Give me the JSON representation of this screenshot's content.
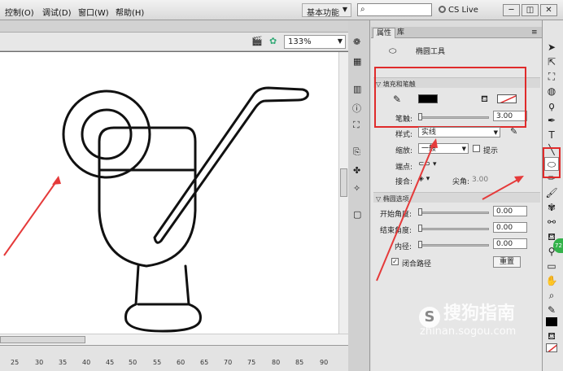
{
  "menu": {
    "items": [
      "控制(O)",
      "调试(D)",
      "窗口(W)",
      "帮助(H)"
    ]
  },
  "workspace": {
    "label": "基本功能"
  },
  "cslive": {
    "label": "CS Live"
  },
  "search": {
    "icon": "search-icon",
    "value": ""
  },
  "window_buttons": [
    "─",
    "◫",
    "✕"
  ],
  "doc": {
    "zoom": "133%"
  },
  "timeline": {
    "ticks": [
      "25",
      "30",
      "35",
      "40",
      "45",
      "50",
      "55",
      "60",
      "65",
      "70",
      "75",
      "80",
      "85",
      "90"
    ]
  },
  "panel": {
    "tabs": [
      "属性",
      "库"
    ],
    "tool_name": "椭圆工具",
    "fill_stroke_section": "填充和笔触",
    "stroke_label": "笔触:",
    "stroke_value": "3.00",
    "style_label": "样式:",
    "style_value": "实线",
    "scale_label": "缩放:",
    "scale_value": "一般",
    "hint_label": "提示",
    "cap_label": "端点:",
    "join_label": "接合:",
    "miter_label": "尖角:",
    "miter_value": "3.00",
    "ellipse_section": "椭圆选项",
    "start_angle_label": "开始角度:",
    "start_angle_value": "0.00",
    "end_angle_label": "结束角度:",
    "end_angle_value": "0.00",
    "inner_radius_label": "内径:",
    "inner_radius_value": "0.00",
    "close_path_label": "闭合路径",
    "reset_label": "重置"
  },
  "colors": {
    "highlight": "#e02b2b",
    "stroke_color": "#000000"
  },
  "badge": {
    "text": "72"
  },
  "watermark": {
    "brand": "搜狗指南",
    "url": "zhinan.sogou.com"
  }
}
